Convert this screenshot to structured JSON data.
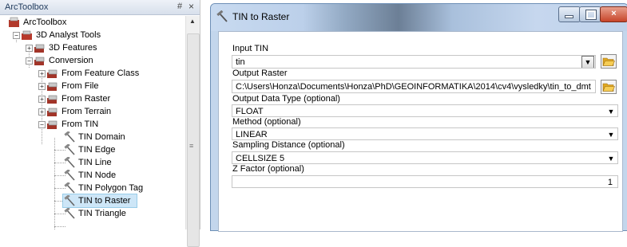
{
  "toolbox": {
    "title": "ArcToolbox",
    "pin_glyph": "#",
    "close_glyph": "×",
    "tree": [
      {
        "label": "ArcToolbox",
        "icon": "arctoolbox-icon"
      },
      {
        "label": "3D Analyst Tools",
        "icon": "toolbox-icon"
      },
      {
        "label": "3D Features",
        "icon": "toolset-icon"
      },
      {
        "label": "Conversion",
        "icon": "toolset-icon"
      },
      {
        "label": "From Feature Class",
        "icon": "toolset-icon"
      },
      {
        "label": "From File",
        "icon": "toolset-icon"
      },
      {
        "label": "From Raster",
        "icon": "toolset-icon"
      },
      {
        "label": "From Terrain",
        "icon": "toolset-icon"
      },
      {
        "label": "From TIN",
        "icon": "toolset-icon"
      },
      {
        "label": "TIN Domain",
        "icon": "hammer-icon"
      },
      {
        "label": "TIN Edge",
        "icon": "hammer-icon"
      },
      {
        "label": "TIN Line",
        "icon": "hammer-icon"
      },
      {
        "label": "TIN Node",
        "icon": "hammer-icon"
      },
      {
        "label": "TIN Polygon Tag",
        "icon": "hammer-icon"
      },
      {
        "label": "TIN to Raster",
        "icon": "hammer-icon"
      },
      {
        "label": "TIN Triangle",
        "icon": "hammer-icon"
      }
    ],
    "selected_item": "TIN to Raster"
  },
  "dialog": {
    "title": "TIN to Raster",
    "fields": {
      "input_tin": {
        "label": "Input TIN",
        "value": "tin"
      },
      "output_raster": {
        "label": "Output Raster",
        "value": "C:\\Users\\Honza\\Documents\\Honza\\PhD\\GEOINFORMATIKA\\2014\\cv4\\vysledky\\tin_to_dmt"
      },
      "output_data_type": {
        "label": "Output Data Type (optional)",
        "value": "FLOAT"
      },
      "method": {
        "label": "Method (optional)",
        "value": "LINEAR"
      },
      "sampling_distance": {
        "label": "Sampling Distance (optional)",
        "value": "CELLSIZE 5"
      },
      "z_factor": {
        "label": "Z Factor (optional)",
        "value": "1"
      }
    }
  },
  "colors": {
    "selection": "#cde6f7",
    "dialog_frame": "#c3d6ec",
    "toolbox_title": "#1e395b"
  }
}
